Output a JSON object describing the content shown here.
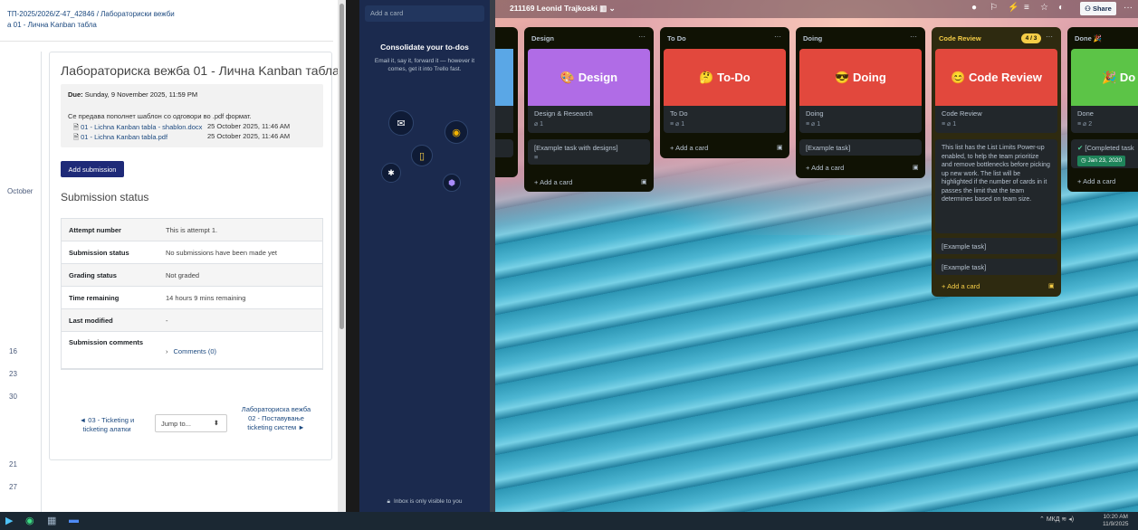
{
  "moodle": {
    "breadcrumb_line1": "ТП-2025/2026/Z-47_42846  /  Лабораториски вежби",
    "breadcrumb_line2": "а 01 - Лична Kanban табла",
    "title": "Лабораториска вежба 01 - Лична Kanban табла",
    "due_label": "Due:",
    "due_value": "Sunday, 9 November 2025, 11:59 PM",
    "description": "Се предава пополнет шаблон со одговори во .pdf формат.",
    "files": [
      {
        "name": "01 - Lichna Kanban tabla - shablon.docx",
        "date": "25 October 2025, 11:46 AM"
      },
      {
        "name": "01 - Lichna Kanban tabla.pdf",
        "date": "25 October 2025, 11:46 AM"
      }
    ],
    "add_submission": "Add submission",
    "submission_status_heading": "Submission status",
    "status_rows": [
      {
        "key": "Attempt number",
        "value": "This is attempt 1."
      },
      {
        "key": "Submission status",
        "value": "No submissions have been made yet"
      },
      {
        "key": "Grading status",
        "value": "Not graded"
      },
      {
        "key": "Time remaining",
        "value": "14 hours 9 mins remaining"
      },
      {
        "key": "Last modified",
        "value": "-"
      },
      {
        "key": "Submission comments",
        "value": "Comments (0)"
      }
    ],
    "prev_link": "◄ 03 - Ticketing и ticketing алатки",
    "jump_to": "Jump to...",
    "next_link": "Лабораториска вежба 02 - Поставување ticketing систем ►",
    "calendar_side": [
      "October",
      "16",
      "23",
      "30",
      "21",
      "27"
    ]
  },
  "inbox": {
    "add_card_placeholder": "Add a card",
    "title": "Consolidate your to-dos",
    "description": "Email it, say it, forward it — however it comes, get it into Trello fast.",
    "footer": "Inbox is only visible to you"
  },
  "board": {
    "name": "211169 Leonid Trajkoski",
    "share": "Share",
    "lists": {
      "design": {
        "header": "Design",
        "cover_title": "Design",
        "cover_color": "#b06ce6",
        "card_title": "Design & Research",
        "card_badge": "1",
        "task": "[Example task with designs]",
        "add_card": "Add a card"
      },
      "todo": {
        "header": "To Do",
        "cover_title": "To-Do",
        "cover_color": "#e2483d",
        "card_title": "To Do",
        "card_badge": "1",
        "add_card": "Add a card"
      },
      "doing": {
        "header": "Doing",
        "cover_title": "Doing",
        "cover_color": "#e2483d",
        "card_title": "Doing",
        "card_badge": "1",
        "task": "[Example task]",
        "add_card": "Add a card"
      },
      "review": {
        "header": "Code Review",
        "badge": "4 / 3",
        "cover_title": "Code Review",
        "cover_color": "#e2483d",
        "card_title": "Code Review",
        "card_badge": "1",
        "note": "This list has the List Limits Power-up enabled, to help the team prioritize and remove bottlenecks before picking up new work. The list will be highlighted if the number of cards in it passes the limit that the team determines based on team size.",
        "task1": "[Example task]",
        "task2": "[Example task]",
        "add_card": "Add a card"
      },
      "done": {
        "header": "Done",
        "cover_title": "Do",
        "cover_color": "#5cc447",
        "card_title": "Done",
        "card_badge": "2",
        "task": "[Completed task",
        "task_date": "Jan 23, 2020",
        "add_card": "Add a card"
      }
    }
  },
  "taskbar": {
    "tray": "МКД",
    "time": "10:20 AM",
    "date": "11/9/2025"
  }
}
